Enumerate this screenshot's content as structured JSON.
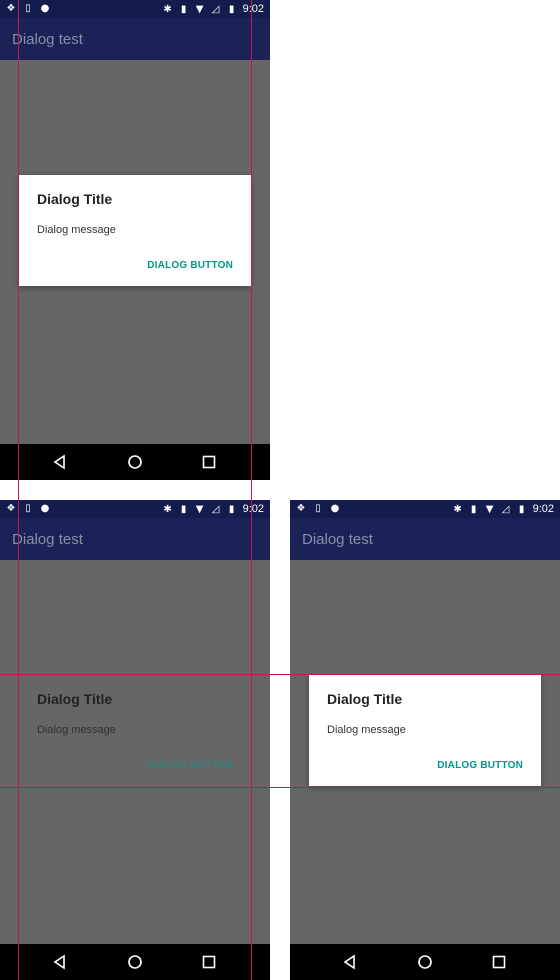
{
  "status_bar": {
    "time": "9:02",
    "left_icons": [
      "dropbox-icon",
      "sim-icon",
      "android-icon"
    ],
    "right_icons": [
      "bluetooth-icon",
      "vibrate-icon",
      "wifi-icon",
      "signal-icon",
      "battery-icon"
    ]
  },
  "app_bar": {
    "title": "Dialog test"
  },
  "dialog": {
    "title": "Dialog Title",
    "message": "Dialog message",
    "button_label": "DIALOG BUTTON"
  },
  "nav_bar": {
    "buttons": [
      "back-icon",
      "home-icon",
      "recents-icon"
    ]
  },
  "colors": {
    "status_bar": "#141b4d",
    "app_bar": "#1a2258",
    "scrim": "#666666",
    "accent": "#009688",
    "guide_lines": "#c2185b"
  }
}
